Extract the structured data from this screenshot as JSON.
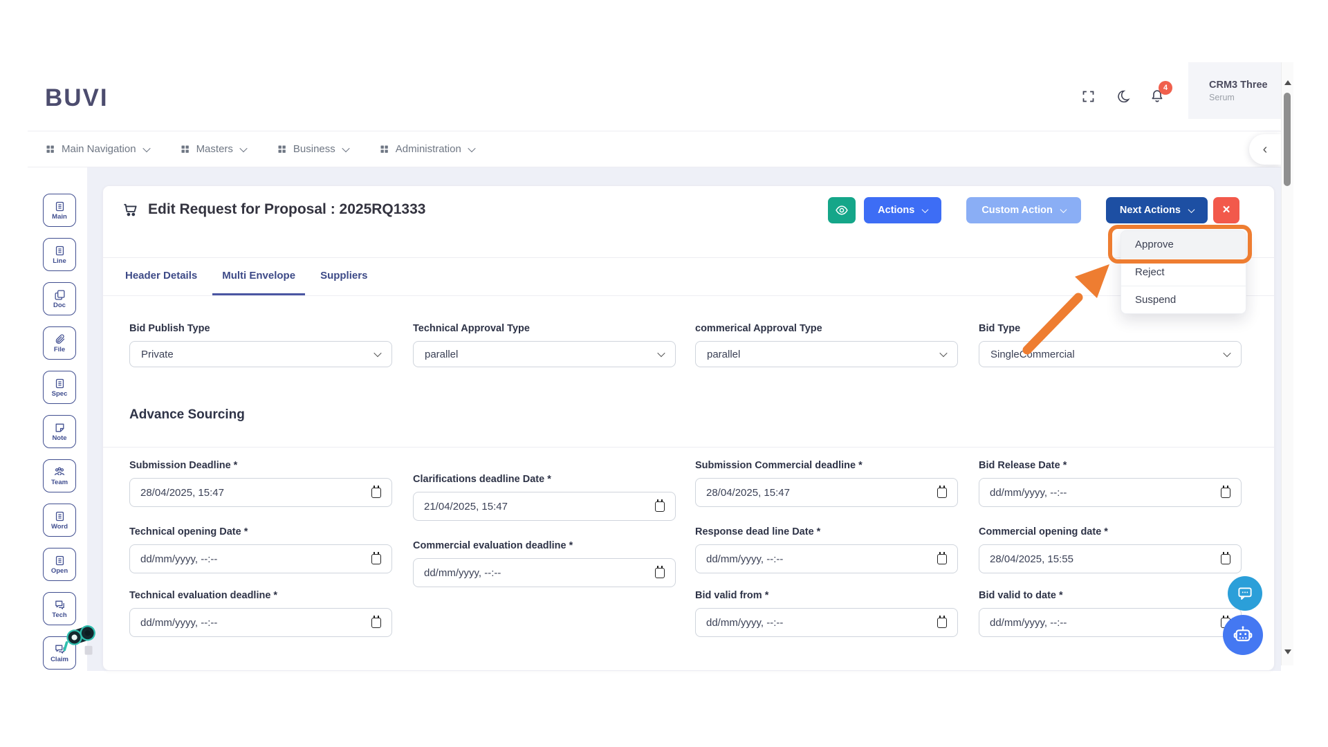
{
  "header": {
    "logo_text": "BUVI",
    "notification_badge": "4",
    "user_name": "CRM3 Three",
    "user_role": "Serum"
  },
  "navbar": {
    "items": [
      {
        "label": "Main Navigation",
        "icon": "grid-icon"
      },
      {
        "label": "Masters",
        "icon": "grid-icon"
      },
      {
        "label": "Business",
        "icon": "grid-icon"
      },
      {
        "label": "Administration",
        "icon": "grid-icon"
      }
    ],
    "collapse_label": "‹"
  },
  "sidebar": {
    "items": [
      {
        "label": "Main",
        "icon": "doc-lines-icon"
      },
      {
        "label": "Line",
        "icon": "doc-lines-icon"
      },
      {
        "label": "Doc",
        "icon": "copy-icon"
      },
      {
        "label": "File",
        "icon": "paperclip-icon"
      },
      {
        "label": "Spec",
        "icon": "doc-lines-icon"
      },
      {
        "label": "Note",
        "icon": "note-icon"
      },
      {
        "label": "Team",
        "icon": "team-icon"
      },
      {
        "label": "Word",
        "icon": "doc-lines-icon"
      },
      {
        "label": "Open",
        "icon": "doc-lines-icon"
      },
      {
        "label": "Tech",
        "icon": "chat-icon"
      },
      {
        "label": "Claim",
        "icon": "chat-icon"
      }
    ]
  },
  "page": {
    "title": "Edit Request for Proposal : 2025RQ1333",
    "buttons": {
      "actions": "Actions",
      "custom_action": "Custom Action",
      "next_actions": "Next Actions",
      "close": "×"
    },
    "next_actions_menu": [
      "Approve",
      "Reject",
      "Suspend"
    ],
    "tabs": [
      {
        "label": "Header Details",
        "active": false
      },
      {
        "label": "Multi Envelope",
        "active": true
      },
      {
        "label": "Suppliers",
        "active": false
      }
    ]
  },
  "form": {
    "selects": [
      {
        "label": "Bid Publish Type",
        "value": "Private"
      },
      {
        "label": "Technical Approval Type",
        "value": "parallel"
      },
      {
        "label": "commerical Approval Type",
        "value": "parallel"
      },
      {
        "label": "Bid Type",
        "value": "SingleCommercial"
      }
    ],
    "section_title": "Advance Sourcing",
    "dates": [
      {
        "label": "Submission Deadline *",
        "value": "28/04/2025, 15:47",
        "col": 1
      },
      {
        "label": "Clarifications deadline Date *",
        "value": "21/04/2025, 15:47",
        "col": 2
      },
      {
        "label": "Submission Commercial deadline *",
        "value": "28/04/2025, 15:47",
        "col": 3
      },
      {
        "label": "Bid Release Date *",
        "value": "dd/mm/yyyy, --:--",
        "col": 4
      },
      {
        "label": "Technical opening Date *",
        "value": "dd/mm/yyyy, --:--",
        "col": 1
      },
      {
        "label": "Commercial evaluation deadline *",
        "value": "dd/mm/yyyy, --:--",
        "col": 2
      },
      {
        "label": "Response dead line Date *",
        "value": "dd/mm/yyyy, --:--",
        "col": 3
      },
      {
        "label": "Commercial opening date *",
        "value": "28/04/2025, 15:55",
        "col": 4
      },
      {
        "label": "Technical evaluation deadline *",
        "value": "dd/mm/yyyy, --:--",
        "col": 1
      },
      {
        "label": "Bid valid from *",
        "value": "dd/mm/yyyy, --:--",
        "col": 3
      },
      {
        "label": "Bid valid to date *",
        "value": "dd/mm/yyyy, --:--",
        "col": 4
      }
    ]
  },
  "colors": {
    "brand_indigo": "#3f4d8f",
    "actions_blue": "#3d6df5",
    "custom_action_blue": "#8aaef5",
    "next_actions_navy": "#1d4fa3",
    "close_red": "#f2594b",
    "eye_teal": "#15a689",
    "annotation_orange": "#ee7d31",
    "badge_red": "#f0604d",
    "chat_fab_blue": "#2b9fd9",
    "robot_fab_blue": "#4478f2"
  }
}
